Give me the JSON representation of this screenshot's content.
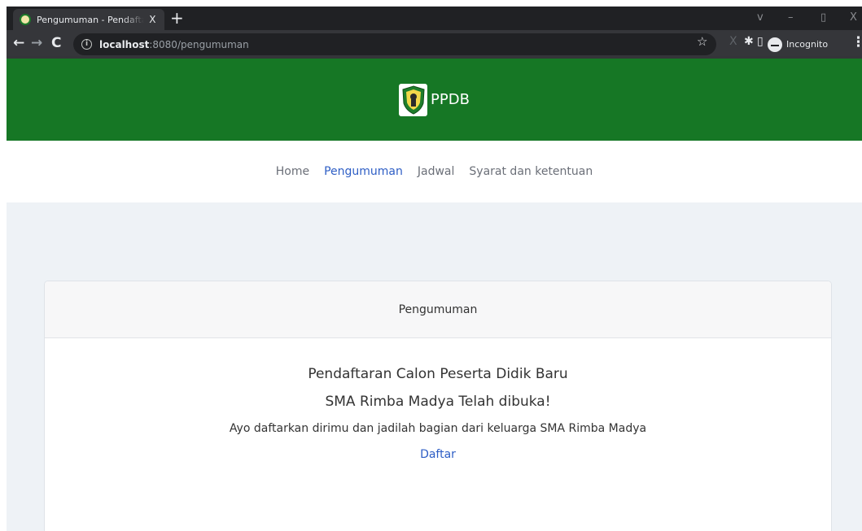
{
  "browser": {
    "tab_title": "Pengumuman - Pendaftaran siswa",
    "tab_close": "X",
    "new_tab": "+",
    "url_host": "localhost",
    "url_path": ":8080/pengumuman",
    "incognito_label": "Incognito",
    "icons": {
      "back": "←",
      "forward": "→",
      "reload": "C",
      "star": "☆",
      "puzzle": "✱",
      "sidepanel": "▯",
      "menu": "⋮",
      "minimize": "–",
      "restore": "▯",
      "close": "X",
      "down": "v"
    }
  },
  "site": {
    "brand": "PPDB",
    "nav": [
      {
        "label": "Home"
      },
      {
        "label": "Pengumuman"
      },
      {
        "label": "Jadwal"
      },
      {
        "label": "Syarat dan ketentuan"
      }
    ],
    "active_nav": "Pengumuman",
    "brand_color": "#167725",
    "accent_color": "#2e5ec5"
  },
  "card": {
    "header": "Pengumuman",
    "line1": "Pendaftaran Calon Peserta Didik Baru",
    "line2": "SMA Rimba Madya Telah dibuka!",
    "line3": "Ayo daftarkan dirimu dan jadilah bagian dari keluarga SMA Rimba Madya",
    "link": "Daftar"
  }
}
